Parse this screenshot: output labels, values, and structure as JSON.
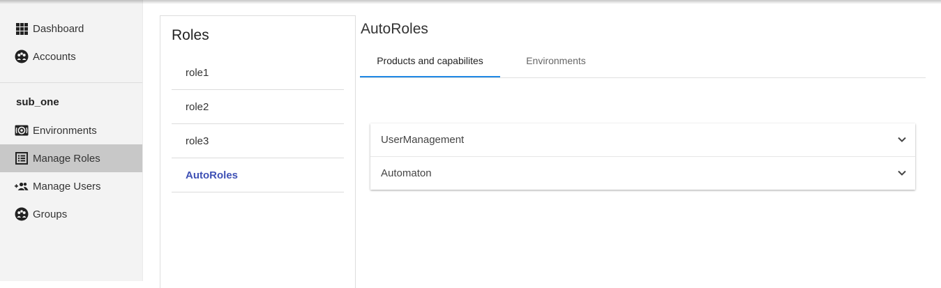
{
  "sidebar": {
    "items_top": [
      {
        "label": "Dashboard",
        "icon": "grid-icon"
      },
      {
        "label": "Accounts",
        "icon": "group-circle-icon"
      }
    ],
    "section_label": "sub_one",
    "items_section": [
      {
        "label": "Environments",
        "icon": "environment-icon"
      },
      {
        "label": "Manage Roles",
        "icon": "list-icon",
        "active": true
      },
      {
        "label": "Manage Users",
        "icon": "add-users-icon"
      },
      {
        "label": "Groups",
        "icon": "group-circle-icon"
      }
    ]
  },
  "roles_panel": {
    "title": "Roles",
    "items": [
      "role1",
      "role2",
      "role3",
      "AutoRoles"
    ],
    "selected": "AutoRoles"
  },
  "main": {
    "title": "AutoRoles",
    "tabs": [
      {
        "label": "Products and capabilites",
        "active": true
      },
      {
        "label": "Environments",
        "active": false
      }
    ],
    "accordion": [
      "UserManagement",
      "Automaton"
    ]
  },
  "colors": {
    "accent": "#1e88e5",
    "selected_link": "#3f51b5",
    "sidebar_bg": "#f3f3f3",
    "sidebar_active": "#c8c8c8"
  }
}
